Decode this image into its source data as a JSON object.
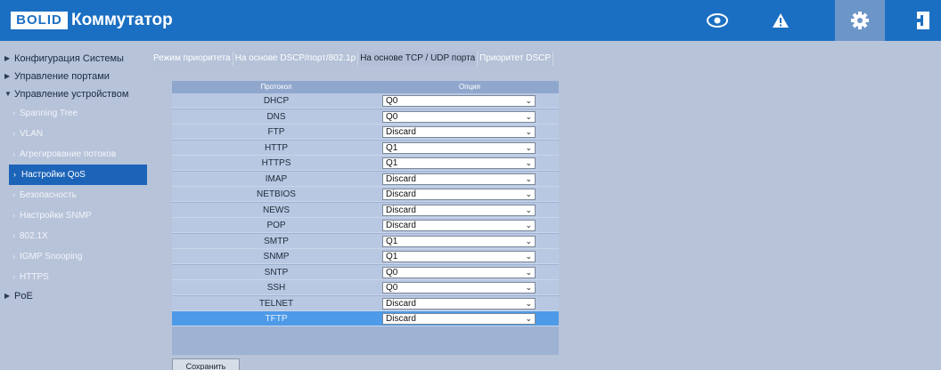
{
  "header": {
    "logo": "BOLID",
    "title": "Коммутатор",
    "icons": [
      "eye-icon",
      "warning-icon",
      "gear-icon",
      "logout-icon"
    ],
    "active_icon": "gear-icon"
  },
  "sidebar": {
    "sections": [
      {
        "label": "Конфигурация Системы",
        "expanded": false
      },
      {
        "label": "Управление портами",
        "expanded": false
      },
      {
        "label": "Управление устройством",
        "expanded": true
      }
    ],
    "sub_items": [
      {
        "label": "Spanning Tree",
        "active": false
      },
      {
        "label": "VLAN",
        "active": false
      },
      {
        "label": "Агрегирование потоков",
        "active": false
      },
      {
        "label": "Настройки QoS",
        "active": true
      },
      {
        "label": "Безопасность",
        "active": false
      },
      {
        "label": "Настройки SNMP",
        "active": false
      },
      {
        "label": "802.1X",
        "active": false
      },
      {
        "label": "IGMP Snooping",
        "active": false
      },
      {
        "label": "HTTPS",
        "active": false
      }
    ],
    "last_section": {
      "label": "PoE",
      "expanded": false
    }
  },
  "tabs": [
    {
      "label": "Режим приоритета",
      "active": false
    },
    {
      "label": "На основе DSCP/порт/802.1p",
      "active": false
    },
    {
      "label": "На основе TCP / UDP порта",
      "active": true
    },
    {
      "label": "Приоритет DSCP",
      "active": false
    }
  ],
  "table": {
    "headers": {
      "protocol": "Протокол",
      "option": "Опция"
    },
    "rows": [
      {
        "protocol": "DHCP",
        "option": "Q0"
      },
      {
        "protocol": "DNS",
        "option": "Q0"
      },
      {
        "protocol": "FTP",
        "option": "Discard"
      },
      {
        "protocol": "HTTP",
        "option": "Q1"
      },
      {
        "protocol": "HTTPS",
        "option": "Q1"
      },
      {
        "protocol": "IMAP",
        "option": "Discard"
      },
      {
        "protocol": "NETBIOS",
        "option": "Discard"
      },
      {
        "protocol": "NEWS",
        "option": "Discard"
      },
      {
        "protocol": "POP",
        "option": "Discard"
      },
      {
        "protocol": "SMTP",
        "option": "Q1"
      },
      {
        "protocol": "SNMP",
        "option": "Q1"
      },
      {
        "protocol": "SNTP",
        "option": "Q0"
      },
      {
        "protocol": "SSH",
        "option": "Q0"
      },
      {
        "protocol": "TELNET",
        "option": "Discard"
      },
      {
        "protocol": "TFTP",
        "option": "Discard",
        "selected": true
      }
    ]
  },
  "save_button": "Сохранить",
  "colors": {
    "header": "#1b6fc2",
    "background": "#b7c3d9",
    "active_nav": "#1c64b8",
    "selected_row": "#4d9ae8"
  }
}
